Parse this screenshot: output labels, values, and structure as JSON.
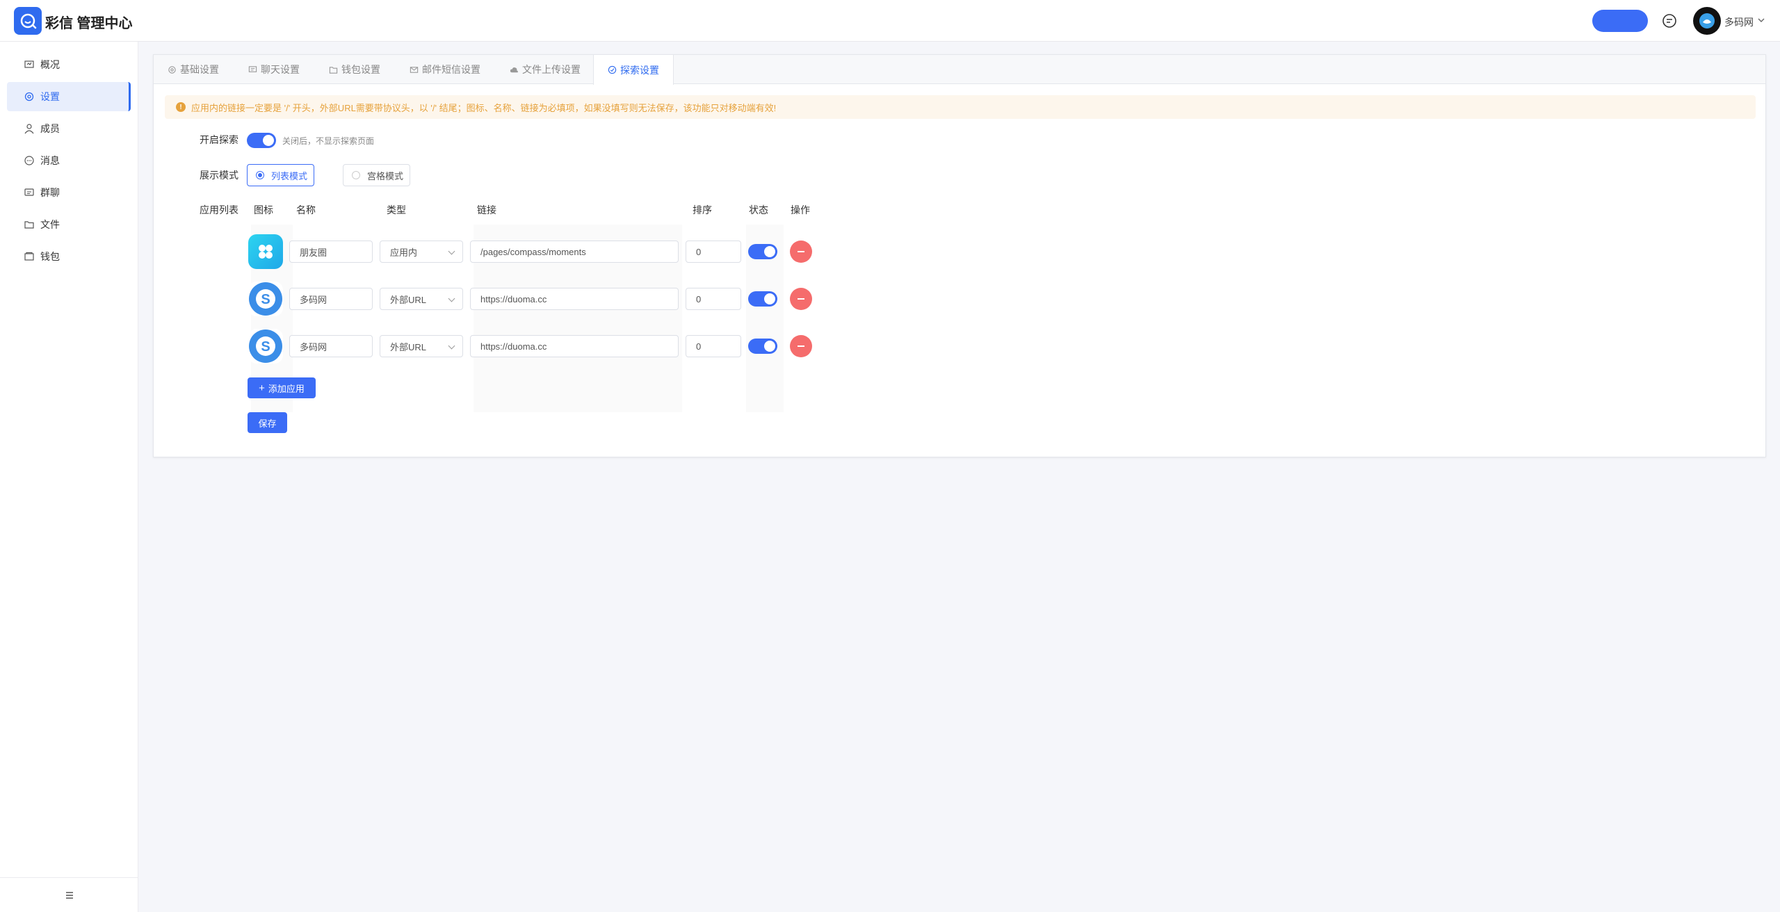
{
  "header": {
    "app_title": "彩信 管理中心",
    "username": "多码网"
  },
  "sidebar": {
    "items": [
      {
        "label": "概况",
        "icon": "overview-icon"
      },
      {
        "label": "设置",
        "icon": "gear-icon",
        "active": true
      },
      {
        "label": "成员",
        "icon": "user-icon"
      },
      {
        "label": "消息",
        "icon": "message-icon"
      },
      {
        "label": "群聊",
        "icon": "group-chat-icon"
      },
      {
        "label": "文件",
        "icon": "folder-icon"
      },
      {
        "label": "钱包",
        "icon": "wallet-icon"
      }
    ]
  },
  "tabs": [
    {
      "label": "基础设置",
      "icon": "gear-icon"
    },
    {
      "label": "聊天设置",
      "icon": "chat-icon"
    },
    {
      "label": "钱包设置",
      "icon": "wallet-icon"
    },
    {
      "label": "邮件短信设置",
      "icon": "mail-icon"
    },
    {
      "label": "文件上传设置",
      "icon": "cloud-upload-icon"
    },
    {
      "label": "探索设置",
      "icon": "compass-icon",
      "active": true
    }
  ],
  "alert": "应用内的链接一定要是 '/' 开头，外部URL需要带协议头，以 '/' 结尾；图标、名称、链接为必填项，如果没填写则无法保存，该功能只对移动端有效!",
  "explore": {
    "enable_label": "开启探索",
    "enabled": true,
    "enable_hint": "关闭后，不显示探索页面",
    "mode_label": "展示模式",
    "modes": [
      {
        "label": "列表模式",
        "selected": true
      },
      {
        "label": "宫格模式",
        "selected": false
      }
    ]
  },
  "app_list": {
    "label": "应用列表",
    "columns": {
      "icon": "图标",
      "name": "名称",
      "type": "类型",
      "link": "链接",
      "order": "排序",
      "status": "状态",
      "action": "操作"
    },
    "rows": [
      {
        "icon": "moments-icon",
        "name": "朋友圈",
        "type": "应用内",
        "link": "/pages/compass/moments",
        "order": "0",
        "enabled": true
      },
      {
        "icon": "skype-icon",
        "name": "多码网",
        "type": "外部URL",
        "link": "https://duoma.cc",
        "order": "0",
        "enabled": true
      },
      {
        "icon": "skype-icon",
        "name": "多码网",
        "type": "外部URL",
        "link": "https://duoma.cc",
        "order": "0",
        "enabled": true
      }
    ],
    "add_label": "添加应用",
    "save_label": "保存"
  },
  "colors": {
    "primary": "#3b6cf6",
    "danger": "#f56c6c",
    "warning": "#e6a23c"
  }
}
